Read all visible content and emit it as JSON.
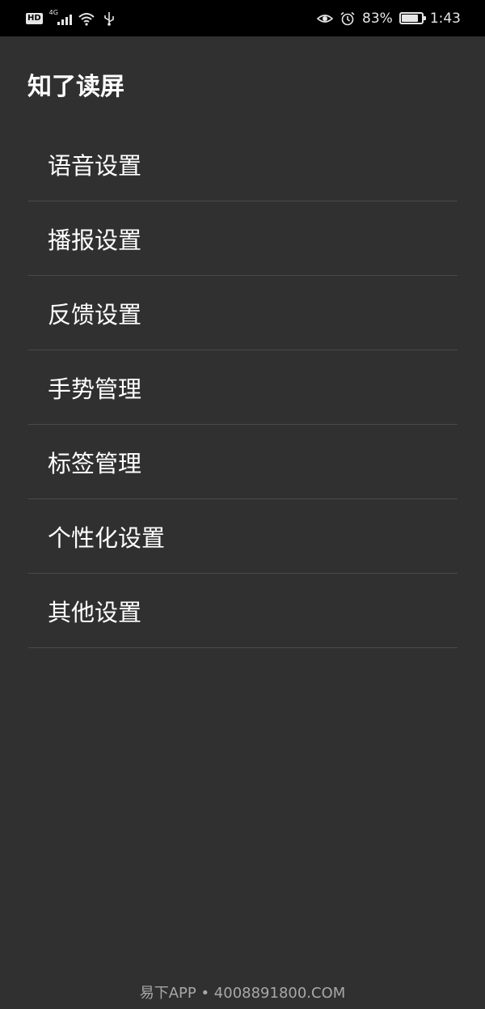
{
  "status_bar": {
    "hd_label": "HD",
    "network_label": "4G",
    "battery_percent": "83%",
    "battery_level": 0.83,
    "time": "1:43"
  },
  "app": {
    "title": "知了读屏"
  },
  "menu": {
    "items": [
      {
        "label": "语音设置"
      },
      {
        "label": "播报设置"
      },
      {
        "label": "反馈设置"
      },
      {
        "label": "手势管理"
      },
      {
        "label": "标签管理"
      },
      {
        "label": "个性化设置"
      },
      {
        "label": "其他设置"
      }
    ]
  },
  "watermark": {
    "text": "易下APP • 4008891800.COM"
  },
  "colors": {
    "background": "#303030",
    "status_bar": "#000000",
    "divider": "#4a4a4a",
    "text": "#ffffff"
  }
}
